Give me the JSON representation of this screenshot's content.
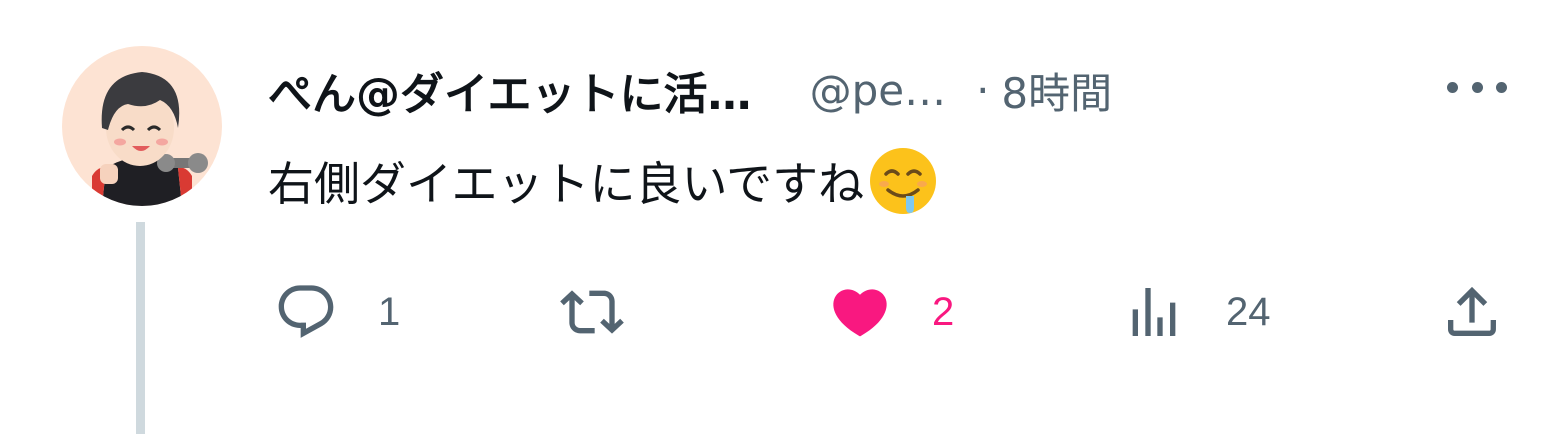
{
  "post": {
    "author_name": "ぺん@ダイエットに活…",
    "handle": "@pe…",
    "separator": "·",
    "time": "8時間",
    "text": "右側ダイエットに良いですね",
    "emoji": "drooling-smiling-face-emoji"
  },
  "actions": {
    "reply_count": "1",
    "repost_count": "",
    "like_count": "2",
    "views_count": "24"
  },
  "icons": {
    "reply": "speech-bubble-icon",
    "repost": "repost-arrows-icon",
    "like": "heart-icon",
    "views": "bar-chart-icon",
    "share": "share-upload-icon",
    "more": "more-dots-icon"
  },
  "colors": {
    "text_primary": "#0f1419",
    "text_secondary": "#536471",
    "like_active": "#f91880",
    "thread_line": "#cfd9de",
    "avatar_bg": "#fde3d3"
  }
}
